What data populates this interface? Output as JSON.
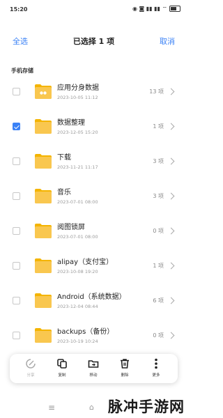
{
  "status_bar": {
    "time": "15:20",
    "icons_text": "◉ ◙ ▮▮ ▮▮ ⌔"
  },
  "header": {
    "select_all": "全选",
    "title": "已选择 1 项",
    "cancel": "取消"
  },
  "section_label": "手机存储",
  "items": [
    {
      "name": "应用分身数据",
      "date": "2023-10-05 11:12",
      "count": "13 项",
      "checked": false,
      "badge": true
    },
    {
      "name": "数据整理",
      "date": "2023-12-05 15:20",
      "count": "1 项",
      "checked": true,
      "badge": false
    },
    {
      "name": "下载",
      "date": "2023-11-21 11:17",
      "count": "3 项",
      "checked": false,
      "badge": false
    },
    {
      "name": "音乐",
      "date": "2023-07-01 08:00",
      "count": "3 项",
      "checked": false,
      "badge": false
    },
    {
      "name": "阅图锁屏",
      "date": "2023-07-01 08:00",
      "count": "0 项",
      "checked": false,
      "badge": false
    },
    {
      "name": "alipay（支付宝）",
      "date": "2023-10-08 19:20",
      "count": "1 项",
      "checked": false,
      "badge": false
    },
    {
      "name": "Android（系统数据）",
      "date": "2023-12-04 08:44",
      "count": "6 项",
      "checked": false,
      "badge": false
    },
    {
      "name": "backups（备份）",
      "date": "2023-10-19 10:24",
      "count": "0 项",
      "checked": false,
      "badge": false
    }
  ],
  "actions": [
    {
      "label": "分享",
      "icon": "share-icon",
      "disabled": true
    },
    {
      "label": "复制",
      "icon": "copy-icon",
      "disabled": false
    },
    {
      "label": "移动",
      "icon": "move-folder-icon",
      "disabled": false
    },
    {
      "label": "删除",
      "icon": "trash-icon",
      "disabled": false
    },
    {
      "label": "更多",
      "icon": "more-icon",
      "disabled": false
    }
  ],
  "nav": {
    "menu_glyph": "≡",
    "home_glyph": "⌂"
  },
  "watermark": "脉冲手游网",
  "colors": {
    "accent": "#3b82f6",
    "folder": "#f9c74f",
    "folder_tab": "#f4b400"
  }
}
